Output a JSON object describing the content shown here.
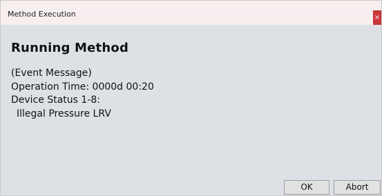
{
  "window": {
    "title": "Method Execution",
    "close_glyph": "×"
  },
  "content": {
    "heading": "Running Method",
    "lines": [
      "(Event Message)",
      "Operation Time: 0000d 00:20",
      "Device Status 1-8:",
      "Illegal Pressure LRV"
    ]
  },
  "buttons": {
    "ok": "OK",
    "abort": "Abort"
  },
  "colors": {
    "close_button": "#c8353b",
    "titlebar": "#f7efef",
    "background": "#dde1e6"
  },
  "icons": {
    "close": "close-icon"
  }
}
